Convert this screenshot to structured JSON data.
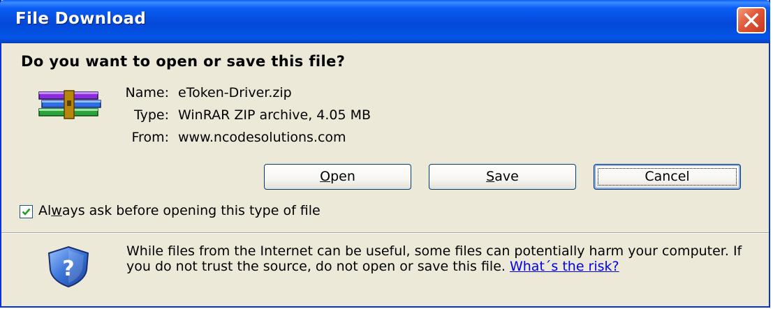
{
  "window": {
    "title": "File Download"
  },
  "dialog": {
    "question": "Do you want to open or save this file?",
    "file": {
      "name_label": "Name:",
      "name_value": "eToken-Driver.zip",
      "type_label": "Type:",
      "type_value": "WinRAR ZIP archive, 4.05 MB",
      "from_label": "From:",
      "from_value": "www.ncodesolutions.com"
    },
    "buttons": {
      "open": {
        "accel": "O",
        "rest": "pen"
      },
      "save": {
        "accel": "S",
        "rest": "ave"
      },
      "cancel": "Cancel"
    },
    "checkbox": {
      "checked": true,
      "label_pre": "Al",
      "label_accel": "w",
      "label_post": "ays ask before opening this type of file"
    },
    "warning": {
      "text": "While files from the Internet can be useful, some files can potentially harm your computer. If you do not trust the source, do not open or save this file. ",
      "link": "What´s the risk?"
    }
  },
  "icons": {
    "file_icon": "winrar-archive-icon",
    "security_icon": "security-shield-question-icon",
    "close_icon": "close-x-icon"
  },
  "colors": {
    "titlebar": "#0448d8",
    "dialog_bg": "#ece9d8",
    "close_button": "#e0583a",
    "link": "#0000ee",
    "checkmark": "#21a121"
  }
}
